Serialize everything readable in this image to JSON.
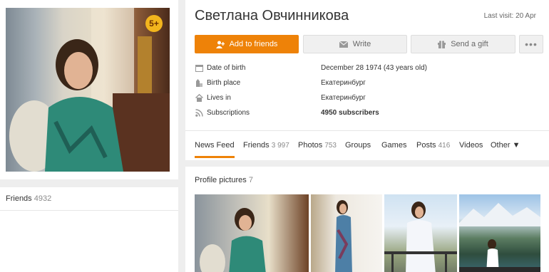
{
  "profile": {
    "name": "Светлана Овчинникова",
    "last_visit": "Last visit: 20 Apr",
    "age_badge": "5+"
  },
  "actions": {
    "add_friends": "Add to friends",
    "write": "Write",
    "send_gift": "Send a gift",
    "more": "•••"
  },
  "info": {
    "dob_label": "Date of birth",
    "dob_value": "December 28 1974 (43 years old)",
    "birthplace_label": "Birth place",
    "birthplace_value": "Екатеринбург",
    "lives_label": "Lives in",
    "lives_value": "Екатеринбург",
    "subs_label": "Subscriptions",
    "subs_value": "4950 subscribers"
  },
  "tabs": {
    "news_feed": "News Feed",
    "friends": "Friends",
    "friends_count": "3 997",
    "photos": "Photos",
    "photos_count": "753",
    "groups": "Groups",
    "games": "Games",
    "posts": "Posts",
    "posts_count": "416",
    "videos": "Videos",
    "other": "Other ▼"
  },
  "friends_panel": {
    "label": "Friends",
    "count": "4932"
  },
  "profile_pictures": {
    "label": "Profile pictures",
    "count": "7"
  },
  "colors": {
    "accent": "#ee8208",
    "badge": "#f2b51d"
  }
}
